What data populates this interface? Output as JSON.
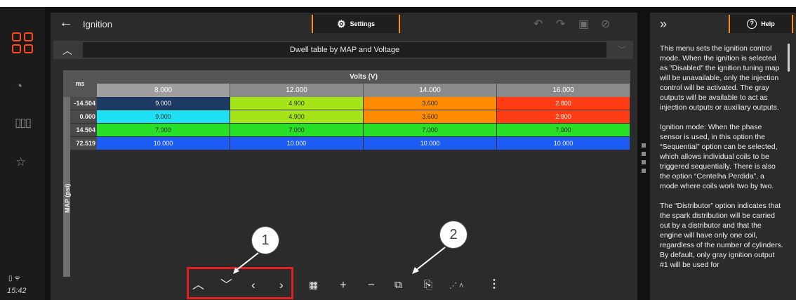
{
  "statusbar": {
    "time": "15:42",
    "icons": "▯ ᯤ"
  },
  "header": {
    "back_icon": "←",
    "title": "Ignition",
    "settings_label": "Settings"
  },
  "section": {
    "title": "Dwell table by MAP and Voltage"
  },
  "table": {
    "corner": "ms",
    "columns_title": "Volts (V)",
    "rows_title": "MAP (psi)",
    "columns": [
      "8.000",
      "12.000",
      "14.000",
      "16.000"
    ],
    "rows": [
      {
        "label": "-14.504",
        "values": [
          "9.000",
          "4.900",
          "3.600",
          "2.800"
        ]
      },
      {
        "label": "0.000",
        "values": [
          "9.000",
          "4.900",
          "3.600",
          "2.800"
        ]
      },
      {
        "label": "14.504",
        "values": [
          "7.000",
          "7.000",
          "7.000",
          "7.000"
        ]
      },
      {
        "label": "72.519",
        "values": [
          "10.000",
          "10.000",
          "10.000",
          "10.000"
        ]
      }
    ],
    "cell_colors": [
      [
        "#1c3a63",
        "#a4e418",
        "#ff8c00",
        "#ff3c14"
      ],
      [
        "#1fe0f4",
        "#a4e418",
        "#ff8c00",
        "#ff3c14"
      ],
      [
        "#28e028",
        "#28e028",
        "#28e028",
        "#28e028"
      ],
      [
        "#1c5cf4",
        "#1c5cf4",
        "#1c5cf4",
        "#1c5cf4"
      ]
    ]
  },
  "callouts": [
    "1",
    "2"
  ],
  "help": {
    "button_label": "Help",
    "paragraphs": [
      "This menu sets the ignition control mode. When the ignition is selected as “Disabled” the ignition tuning map will be unavailable, only the injection control will be activated. The gray outputs will be available to act as injection outputs or auxiliary outputs.",
      "Ignition mode: When the phase sensor is used, in this option the “Sequential” option can be selected, which allows individual coils to be triggered sequentially. There is also the option “Centelha Perdida”, a mode where coils work two by two.",
      "The “Distributor” option indicates that the spark distribution will be carried out by a distributor and that the engine will have only one coil, regardless of the number of cylinders. By default, only gray ignition output #1 will be used for"
    ]
  }
}
